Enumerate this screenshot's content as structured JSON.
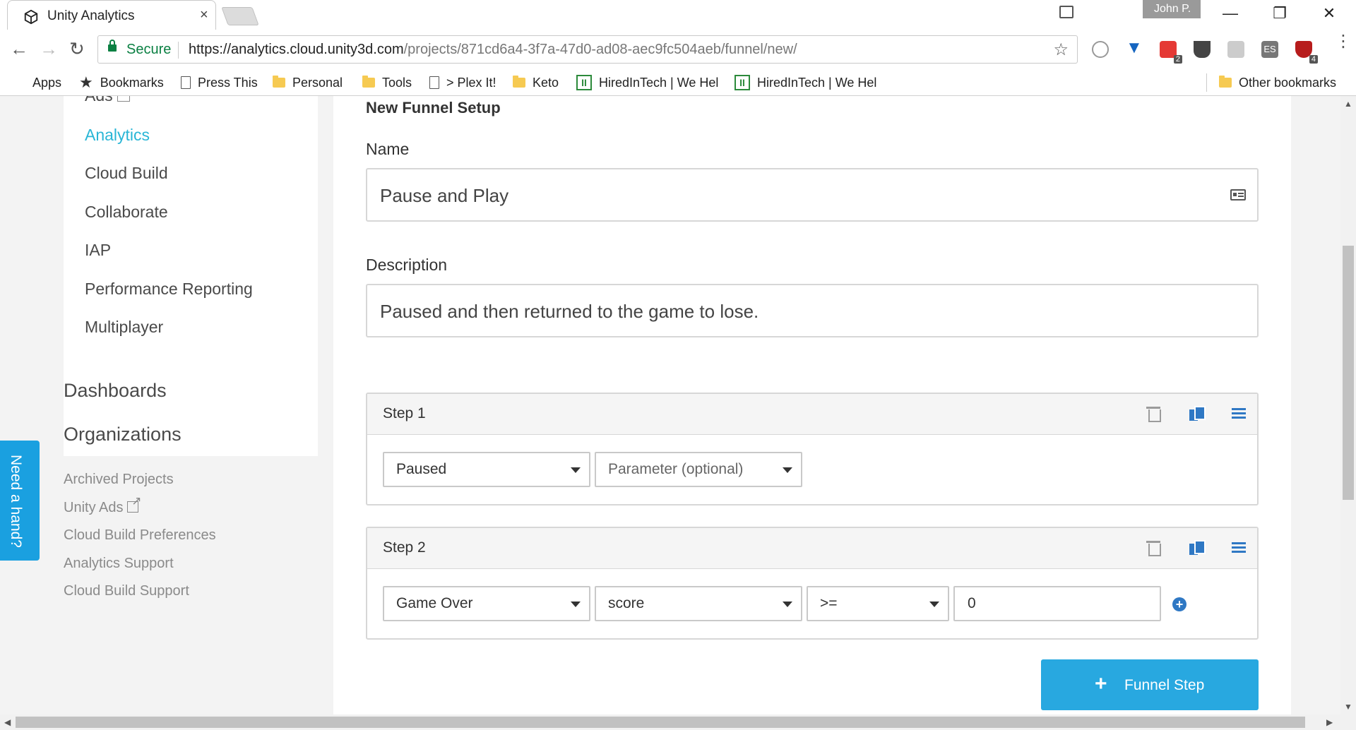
{
  "browser": {
    "tab_title": "Unity Analytics",
    "tab_close": "×",
    "profile_name": "John P.",
    "secure_label": "Secure",
    "url_host": "https://analytics.cloud.unity3d.com",
    "url_path": "/projects/871cd6a4-3f7a-47d0-ad08-aec9fc504aeb/funnel/new/",
    "extension_badges": [
      "2",
      "4"
    ],
    "ext_es_label": "ES"
  },
  "bookmarks": [
    {
      "label": "Apps",
      "icon": "apps-grid-icon"
    },
    {
      "label": "Bookmarks",
      "icon": "star-icon"
    },
    {
      "label": "Press This",
      "icon": "page-icon"
    },
    {
      "label": "Personal",
      "icon": "folder-icon"
    },
    {
      "label": "Tools",
      "icon": "folder-icon"
    },
    {
      "label": "> Plex It!",
      "icon": "page-icon"
    },
    {
      "label": "Keto",
      "icon": "folder-icon"
    },
    {
      "label": "HiredInTech | We Hel",
      "icon": "hiredintech-icon"
    },
    {
      "label": "HiredInTech | We Hel",
      "icon": "hiredintech-icon"
    },
    {
      "label": "Other bookmarks",
      "icon": "folder-icon"
    }
  ],
  "sidebar": {
    "services": [
      "Ads",
      "Analytics",
      "Cloud Build",
      "Collaborate",
      "IAP",
      "Performance Reporting",
      "Multiplayer"
    ],
    "active_service": "Analytics",
    "headings": [
      "Dashboards",
      "Organizations"
    ],
    "links": [
      "Archived Projects",
      "Unity Ads",
      "Cloud Build Preferences",
      "Analytics Support",
      "Cloud Build Support"
    ]
  },
  "help_tab": "Need a hand?",
  "form": {
    "title": "New Funnel Setup",
    "name_label": "Name",
    "name_value": "Pause and Play",
    "description_label": "Description",
    "description_value": "Paused and then returned to the game to lose.",
    "steps": [
      {
        "title": "Step 1",
        "event": "Paused",
        "parameter": "Parameter (optional)"
      },
      {
        "title": "Step 2",
        "event": "Game Over",
        "parameter": "score",
        "operator": ">=",
        "value": "0"
      }
    ],
    "add_step_label": "Funnel Step",
    "add_step_plus": "+"
  },
  "colors": {
    "accent": "#29b6d6",
    "primary_button": "#28a8e0",
    "icon_blue": "#2f78c4",
    "secure_green": "#0b8043"
  }
}
